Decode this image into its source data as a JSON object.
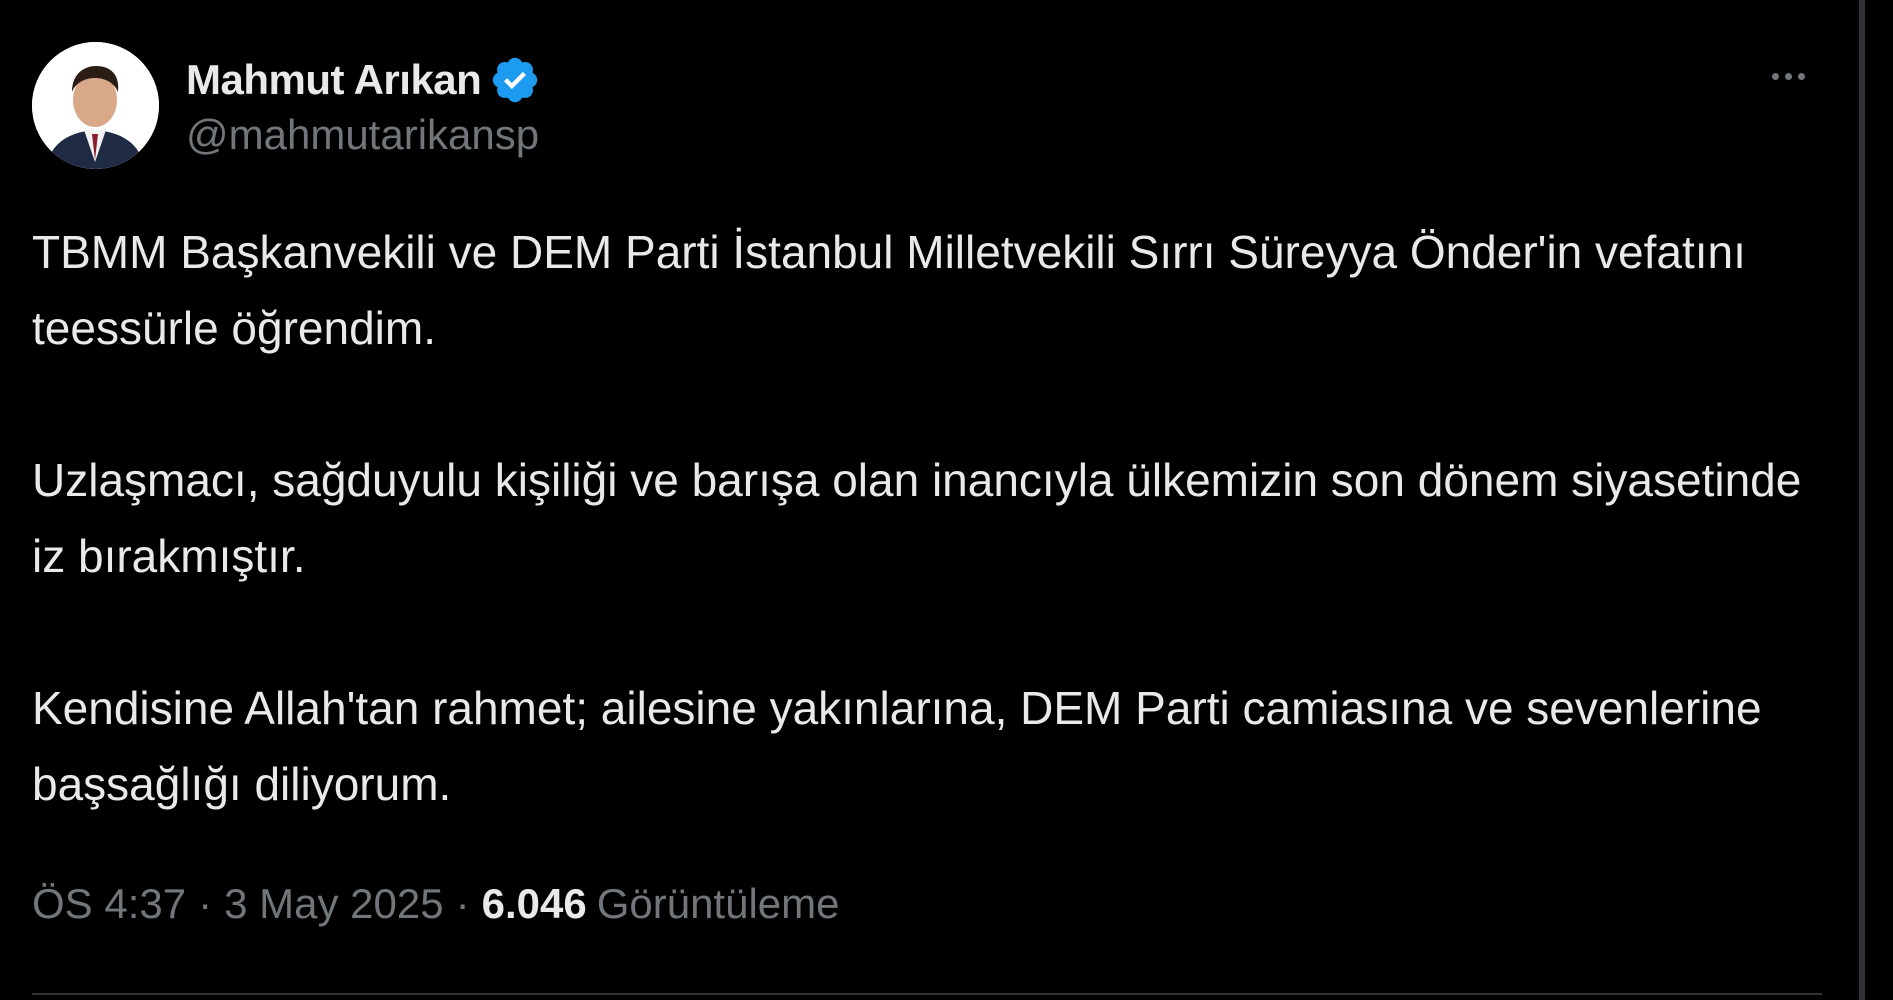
{
  "author": {
    "display_name": "Mahmut Arıkan",
    "handle": "@mahmutarikansp",
    "verified_icon": "verified-badge-icon",
    "verified_color": "#1d9bf0"
  },
  "tweet": {
    "paragraphs": [
      "TBMM Başkanvekili ve DEM Parti İstanbul Milletvekili Sırrı Süreyya Önder'in vefatını teessürle öğrendim.",
      "Uzlaşmacı, sağduyulu kişiliği ve barışa olan inancıyla ülkemizin son dönem siyasetinde iz bırakmıştır.",
      "Kendisine Allah'tan rahmet; ailesine yakınlarına, DEM Parti camiasına ve sevenlerine başsağlığı diliyorum."
    ]
  },
  "meta": {
    "time": "ÖS 4:37",
    "separator": "·",
    "date": "3 May 2025",
    "views_count": "6.046",
    "views_label": "Görüntüleme"
  },
  "menu": {
    "icon": "more-horizontal-icon"
  },
  "colors": {
    "background": "#000000",
    "primary_text": "#e7e9ea",
    "secondary_text": "#71767b",
    "border": "#2f3336"
  }
}
